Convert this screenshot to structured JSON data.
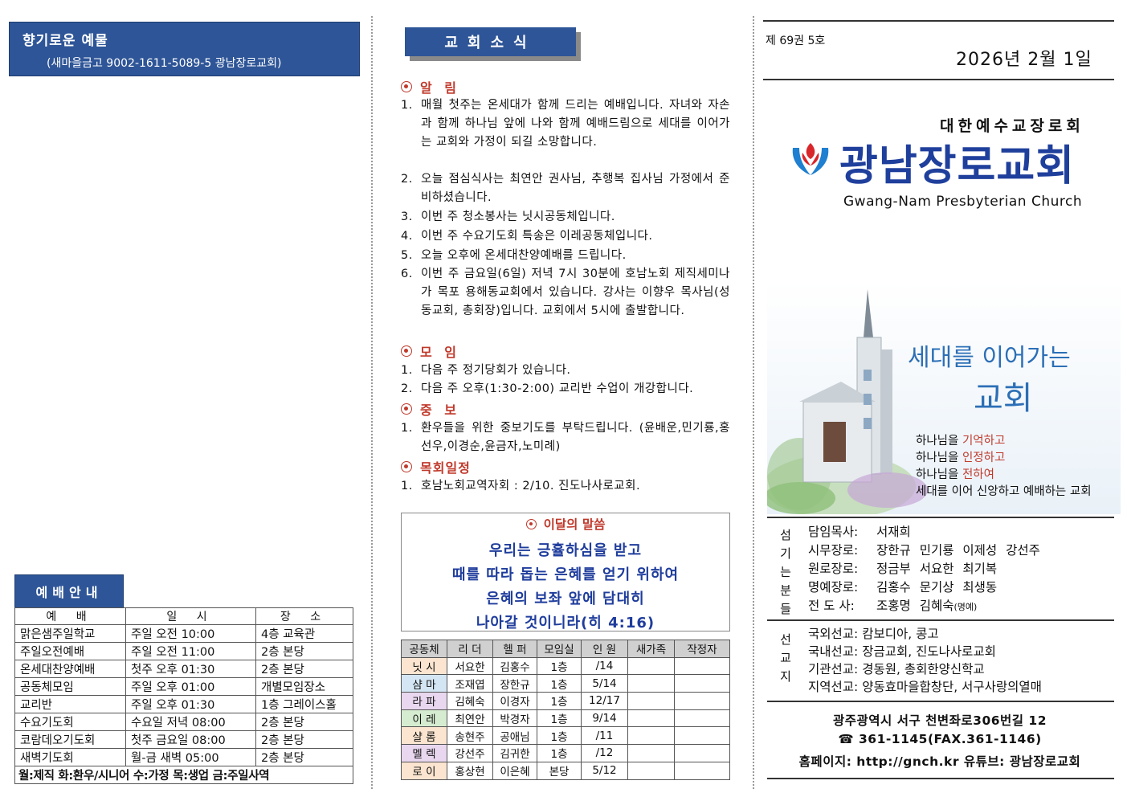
{
  "offering": {
    "title": "향기로운 예물",
    "account": "(새마을금고 9002-1611-5089-5 광남장로교회)"
  },
  "worship": {
    "heading": "예배안내",
    "headers": [
      "예 배",
      "일 시",
      "장 소"
    ],
    "rows": [
      [
        "맑은샘주일학교",
        "주일 오전 10:00",
        "4층 교육관"
      ],
      [
        "주일오전예배",
        "주일 오전 11:00",
        "2층 본당"
      ],
      [
        "온세대찬양예배",
        "첫주 오후 01:30",
        "2층 본당"
      ],
      [
        "공동체모임",
        "주일 오후 01:00",
        "개별모임장소"
      ],
      [
        "교리반",
        "주일 오후 01:30",
        "1층 그레이스홀"
      ],
      [
        "수요기도회",
        "수요일 저녁 08:00",
        "2층 본당"
      ],
      [
        "코람데오기도회",
        "첫주 금요일 08:00",
        "2층 본당"
      ],
      [
        "새벽기도회",
        "월-금 새벽 05:00",
        "2층 본당"
      ]
    ],
    "footer": "월:제직 화:환우/시니어 수:가정 목:생업 금:주일사역"
  },
  "news": {
    "title": "교회소식",
    "sections": {
      "notice": "알 림",
      "meeting": "모 임",
      "prayer": "중 보",
      "schedule": "목회일정"
    },
    "notices": [
      "매월 첫주는 온세대가 함께 드리는 예배입니다. 자녀와 자손과 함께 하나님 앞에 나와 함께 예배드림으로 세대를 이어가는 교회와 가정이 되길 소망합니다.",
      "오늘 점심식사는 최연안 권사님, 추행복 집사님 가정에서 준비하셨습니다.",
      "이번 주 청소봉사는 닛시공동체입니다.",
      "이번 주 수요기도회 특송은 이레공동체입니다.",
      "오늘 오후에 온세대찬양예배를 드립니다.",
      "이번 주 금요일(6일) 저녁 7시 30분에 호남노회 제직세미나가 목포 용해동교회에서 있습니다. 강사는 이향우 목사님(성동교회, 총회장)입니다. 교회에서 5시에 출발합니다."
    ],
    "meetings": [
      "다음 주 정기당회가 있습니다.",
      "다음 주 오후(1:30-2:00) 교리반 수업이 개강합니다."
    ],
    "prayers": [
      "환우들을 위한 중보기도를 부탁드립니다. (윤배운,민기룡,홍선우,이경순,윤금자,노미례)"
    ],
    "schedules": [
      "호남노회교역자회 : 2/10. 진도나사로교회."
    ]
  },
  "verse": {
    "heading": "이달의 말씀",
    "lines": [
      "우리는 긍휼하심을 받고",
      "때를 따라 돕는 은혜를 얻기 위하여",
      "은혜의 보좌 앞에 담대히",
      "나아갈 것이니라(히 4:16)"
    ]
  },
  "groups": {
    "headers": [
      "공동체",
      "리 더",
      "헬 퍼",
      "모임실",
      "인 원",
      "새가족",
      "작정자"
    ],
    "rows": [
      {
        "name": "닛 시",
        "leader": "서요한",
        "helper": "김홍수",
        "room": "1층",
        "count": "/14",
        "new": "",
        "pledge": "",
        "color": "#fbe5d0"
      },
      {
        "name": "샴 마",
        "leader": "조재엽",
        "helper": "장한규",
        "room": "1층",
        "count": "5/14",
        "new": "",
        "pledge": "",
        "color": "#d4e6f3"
      },
      {
        "name": "라 파",
        "leader": "김혜숙",
        "helper": "이경자",
        "room": "1층",
        "count": "12/17",
        "new": "",
        "pledge": "",
        "color": "#e8d7ee"
      },
      {
        "name": "이 레",
        "leader": "최연안",
        "helper": "박경자",
        "room": "1층",
        "count": "9/14",
        "new": "",
        "pledge": "",
        "color": "#d6ecd0"
      },
      {
        "name": "샬 롬",
        "leader": "송현주",
        "helper": "공애님",
        "room": "1층",
        "count": "/11",
        "new": "",
        "pledge": "",
        "color": "#fbe5d0"
      },
      {
        "name": "멜 렉",
        "leader": "강선주",
        "helper": "김귀한",
        "room": "1층",
        "count": "/12",
        "new": "",
        "pledge": "",
        "color": "#e8d7ee"
      },
      {
        "name": "로 이",
        "leader": "홍상현",
        "helper": "이은혜",
        "room": "본당",
        "count": "5/12",
        "new": "",
        "pledge": "",
        "color": "#fbe5d0"
      }
    ]
  },
  "cover": {
    "volume": "제 69권 5호",
    "date": "2026년 2월 1일",
    "denomination": "대한예수교장로회",
    "church_name": "광남장로교회",
    "english_name": "Gwang-Nam Presbyterian Church",
    "slogan_top": "세대를 이어가는",
    "slogan_bottom": "교회",
    "sub_lines": [
      {
        "pre": "하나님을 ",
        "red": "기억하고"
      },
      {
        "pre": "하나님을 ",
        "red": "인정하고"
      },
      {
        "pre": "하나님을 ",
        "red": "전하여"
      },
      {
        "pre": "세대를 이어 신앙하고 예배하는 교회",
        "red": ""
      }
    ]
  },
  "staff": {
    "label": "섬기는분들",
    "rows": [
      {
        "role": "담임목사:",
        "names": "서재희"
      },
      {
        "role": "시무장로:",
        "names": "장한규 민기룡 이제성 강선주"
      },
      {
        "role": "원로장로:",
        "names": "정금부 서요한 최기복"
      },
      {
        "role": "명예장로:",
        "names": "김홍수 문기상 최생동"
      },
      {
        "role": "전 도 사:",
        "names": "조홍명 김혜숙"
      }
    ],
    "honorary": "(명예)"
  },
  "missions": {
    "label": "선교지",
    "rows": [
      "국외선교: 캄보디아, 콩고",
      "국내선교: 장금교회, 진도나사로교회",
      "기관선교: 경동원, 총회한양신학교",
      "지역선교: 양동효마을합창단, 서구사랑의열매"
    ]
  },
  "address": {
    "street": "광주광역시 서구 천변좌로306번길 12",
    "phone": "☎ 361-1145(FAX.361-1146)",
    "web": "홈페이지: http://gnch.kr   유튜브: 광남장로교회"
  }
}
